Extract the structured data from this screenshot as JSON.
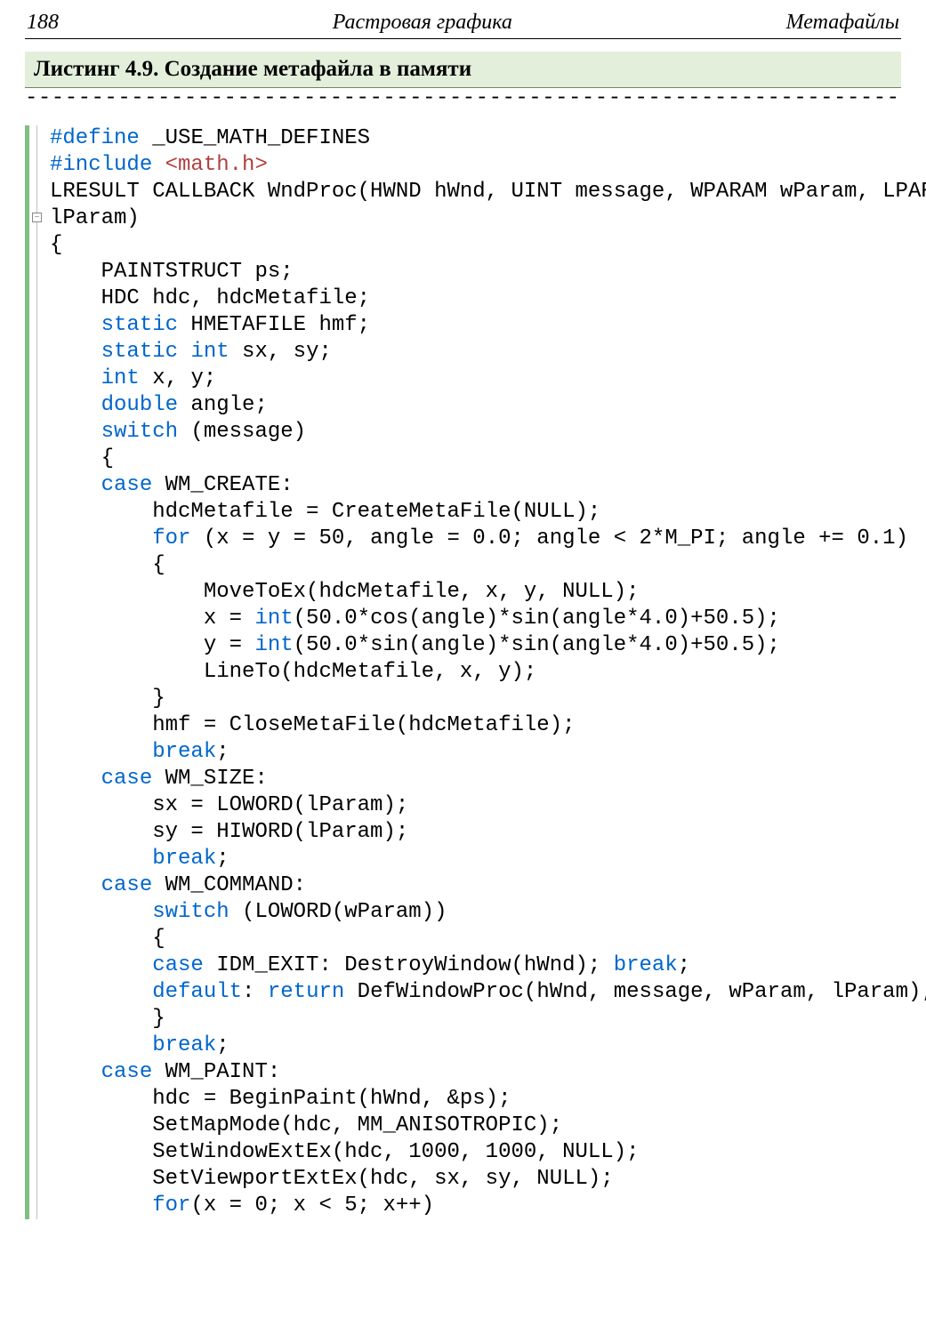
{
  "header": {
    "page_number": "188",
    "left_title": "Растровая графика",
    "right_title": "Метафайлы"
  },
  "listing": {
    "caption": "Листинг 4.9. Создание метафайла в памяти",
    "dashes": "------------------------------------------------------------------------------"
  },
  "code": {
    "t01a": "#define",
    "t01b": " _USE_MATH_DEFINES",
    "t02a": "#include",
    "t02b": " ",
    "t02c": "<math.h>",
    "t03": "LRESULT CALLBACK WndProc(HWND hWnd, UINT message, WPARAM wParam, LPARAM",
    "t04": "lParam)",
    "t05": "{",
    "t06": "    PAINTSTRUCT ps;",
    "t07": "    HDC hdc, hdcMetafile;",
    "t08a": "    ",
    "t08b": "static",
    "t08c": " HMETAFILE hmf;",
    "t09a": "    ",
    "t09b": "static",
    "t09c": " ",
    "t09d": "int",
    "t09e": " sx, sy;",
    "t10a": "    ",
    "t10b": "int",
    "t10c": " x, y;",
    "t11a": "    ",
    "t11b": "double",
    "t11c": " angle;",
    "t12a": "    ",
    "t12b": "switch",
    "t12c": " (message)",
    "t13": "    {",
    "t14a": "    ",
    "t14b": "case",
    "t14c": " WM_CREATE:",
    "t15": "        hdcMetafile = CreateMetaFile(NULL);",
    "t16a": "        ",
    "t16b": "for",
    "t16c": " (x = y = 50, angle = 0.0; angle < 2*M_PI; angle += 0.1)",
    "t17": "        {",
    "t18": "            MoveToEx(hdcMetafile, x, y, NULL);",
    "t19a": "            x = ",
    "t19b": "int",
    "t19c": "(50.0*cos(angle)*sin(angle*4.0)+50.5);",
    "t20a": "            y = ",
    "t20b": "int",
    "t20c": "(50.0*sin(angle)*sin(angle*4.0)+50.5);",
    "t21": "            LineTo(hdcMetafile, x, y);",
    "t22": "        }",
    "t23": "        hmf = CloseMetaFile(hdcMetafile);",
    "t24a": "        ",
    "t24b": "break",
    "t24c": ";",
    "t25a": "    ",
    "t25b": "case",
    "t25c": " WM_SIZE:",
    "t26": "        sx = LOWORD(lParam);",
    "t27": "        sy = HIWORD(lParam);",
    "t28a": "        ",
    "t28b": "break",
    "t28c": ";",
    "t29a": "    ",
    "t29b": "case",
    "t29c": " WM_COMMAND:",
    "t30a": "        ",
    "t30b": "switch",
    "t30c": " (LOWORD(wParam))",
    "t31": "        {",
    "t32a": "        ",
    "t32b": "case",
    "t32c": " IDM_EXIT: DestroyWindow(hWnd); ",
    "t32d": "break",
    "t32e": ";",
    "t33a": "        ",
    "t33b": "default",
    "t33c": ": ",
    "t33d": "return",
    "t33e": " DefWindowProc(hWnd, message, wParam, lParam);",
    "t34": "        }",
    "t35a": "        ",
    "t35b": "break",
    "t35c": ";",
    "t36a": "    ",
    "t36b": "case",
    "t36c": " WM_PAINT:",
    "t37": "        hdc = BeginPaint(hWnd, &ps);",
    "t38": "        SetMapMode(hdc, MM_ANISOTROPIC);",
    "t39": "        SetWindowExtEx(hdc, 1000, 1000, NULL);",
    "t40": "        SetViewportExtEx(hdc, sx, sy, NULL);",
    "t41a": "        ",
    "t41b": "for",
    "t41c": "(x = 0; x < 5; x++)"
  },
  "fold_glyph": "−"
}
